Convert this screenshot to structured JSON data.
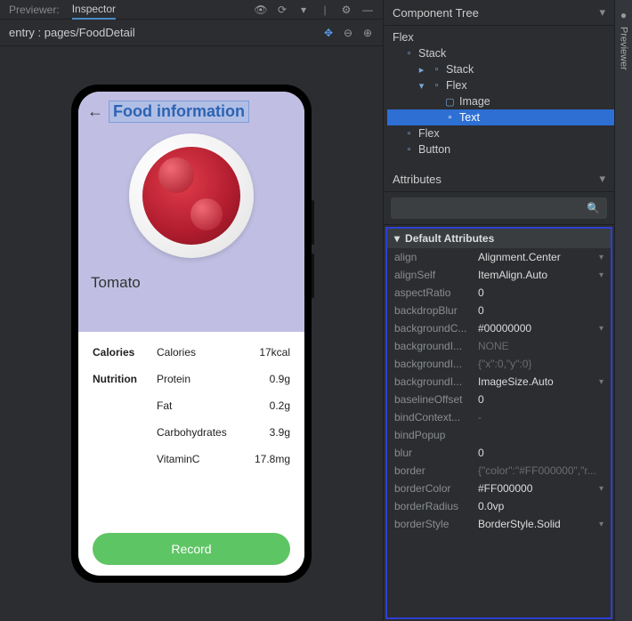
{
  "tabs": {
    "previewer": "Previewer:",
    "inspector": "Inspector"
  },
  "entry": "entry : pages/FoodDetail",
  "sidePanel": {
    "componentTree": "Component Tree",
    "attributes": "Attributes",
    "defaultAttrs": "Default Attributes"
  },
  "tree": {
    "flex": "Flex",
    "stack": "Stack",
    "stack2": "Stack",
    "flex2": "Flex",
    "image": "Image",
    "text": "Text",
    "flex3": "Flex",
    "button": "Button"
  },
  "phone": {
    "title": "Food information",
    "name": "Tomato",
    "calories_label": "Calories",
    "calories_label2": "Calories",
    "calories_val": "17kcal",
    "nutrition_label": "Nutrition",
    "protein": "Protein",
    "protein_val": "0.9g",
    "fat": "Fat",
    "fat_val": "0.2g",
    "carbs": "Carbohydrates",
    "carbs_val": "3.9g",
    "vitc": "VitaminC",
    "vitc_val": "17.8mg",
    "record": "Record"
  },
  "attrs": [
    {
      "k": "align",
      "v": "Alignment.Center",
      "chev": true
    },
    {
      "k": "alignSelf",
      "v": "ItemAlign.Auto",
      "chev": true
    },
    {
      "k": "aspectRatio",
      "v": "0"
    },
    {
      "k": "backdropBlur",
      "v": "0"
    },
    {
      "k": "backgroundC...",
      "v": "#00000000",
      "chev": true
    },
    {
      "k": "backgroundI...",
      "v": "NONE",
      "dim": true
    },
    {
      "k": "backgroundI...",
      "v": "{\"x\":0,\"y\":0}",
      "dim": true
    },
    {
      "k": "backgroundI...",
      "v": "ImageSize.Auto",
      "chev": true
    },
    {
      "k": "baselineOffset",
      "v": "0"
    },
    {
      "k": "bindContext...",
      "v": "-",
      "dim": true
    },
    {
      "k": "bindPopup",
      "v": ""
    },
    {
      "k": "blur",
      "v": "0"
    },
    {
      "k": "border",
      "v": "{\"color\":\"#FF000000\",\"r...",
      "dim": true
    },
    {
      "k": "borderColor",
      "v": "#FF000000",
      "chev": true
    },
    {
      "k": "borderRadius",
      "v": "0.0vp"
    },
    {
      "k": "borderStyle",
      "v": "BorderStyle.Solid",
      "chev": true
    }
  ],
  "gutter": {
    "previewer": "Previewer"
  }
}
